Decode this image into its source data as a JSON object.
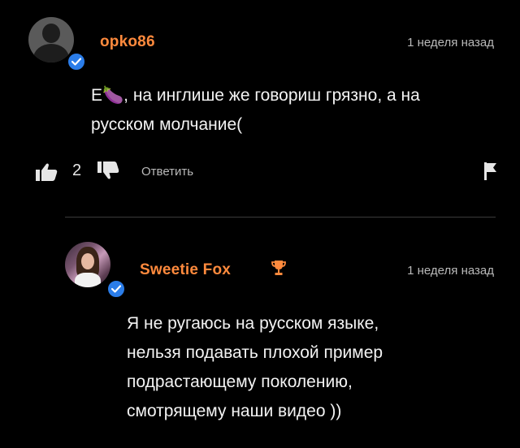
{
  "thread": {
    "comments": [
      {
        "username": "opko86",
        "timestamp": "1 неделя назад",
        "text_lines": [
          "Е🍆, на инглише же говориш грязно, а на",
          "русском молчание("
        ],
        "likes": "2",
        "reply_label": "Ответить",
        "verified": true
      },
      {
        "username": "Sweetie Fox",
        "badge_icon": "trophy-icon",
        "timestamp": "1 неделя назад",
        "text_lines": [
          "Я не ругаюсь на русском языке,",
          "нельзя подавать плохой пример",
          "подрастающему поколению,",
          "смотрящему наши видео ))"
        ],
        "verified": true
      }
    ]
  },
  "colors": {
    "background": "#000000",
    "username": "#ff8a3d",
    "verified": "#2b7de9",
    "text": "#f3f3f3",
    "muted": "#b9b9b9"
  },
  "icons": [
    "like-icon",
    "dislike-icon",
    "flag-icon",
    "verified-badge-icon",
    "trophy-icon"
  ]
}
